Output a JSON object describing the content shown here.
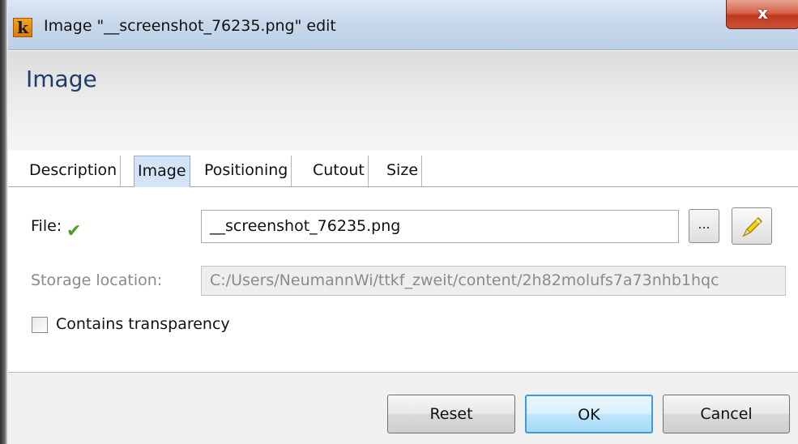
{
  "window": {
    "title": "Image \"__screenshot_76235.png\" edit",
    "app_icon_letter": "k",
    "close_symbol": "x"
  },
  "header": {
    "heading": "Image"
  },
  "tabs": [
    {
      "label": "Description",
      "active": false
    },
    {
      "label": "Image",
      "active": true
    },
    {
      "label": "Positioning",
      "active": false
    },
    {
      "label": "Cutout",
      "active": false
    },
    {
      "label": "Size",
      "active": false
    }
  ],
  "form": {
    "file_label": "File:",
    "file_status_icon": "check-icon",
    "file_value": "__screenshot_76235.png",
    "browse_label": "...",
    "storage_label": "Storage location:",
    "storage_value": "C:/Users/NeumannWi/ttkf_zweit/content/2h82molufs7a73nhb1hqc",
    "transparency_label": "Contains transparency",
    "transparency_checked": false
  },
  "footer": {
    "reset_label": "Reset",
    "ok_label": "OK",
    "cancel_label": "Cancel"
  },
  "colors": {
    "heading": "#1d3c6d",
    "active_tab": "#d4e4f6",
    "check": "#4aa024",
    "close_button": "#c0381d"
  }
}
